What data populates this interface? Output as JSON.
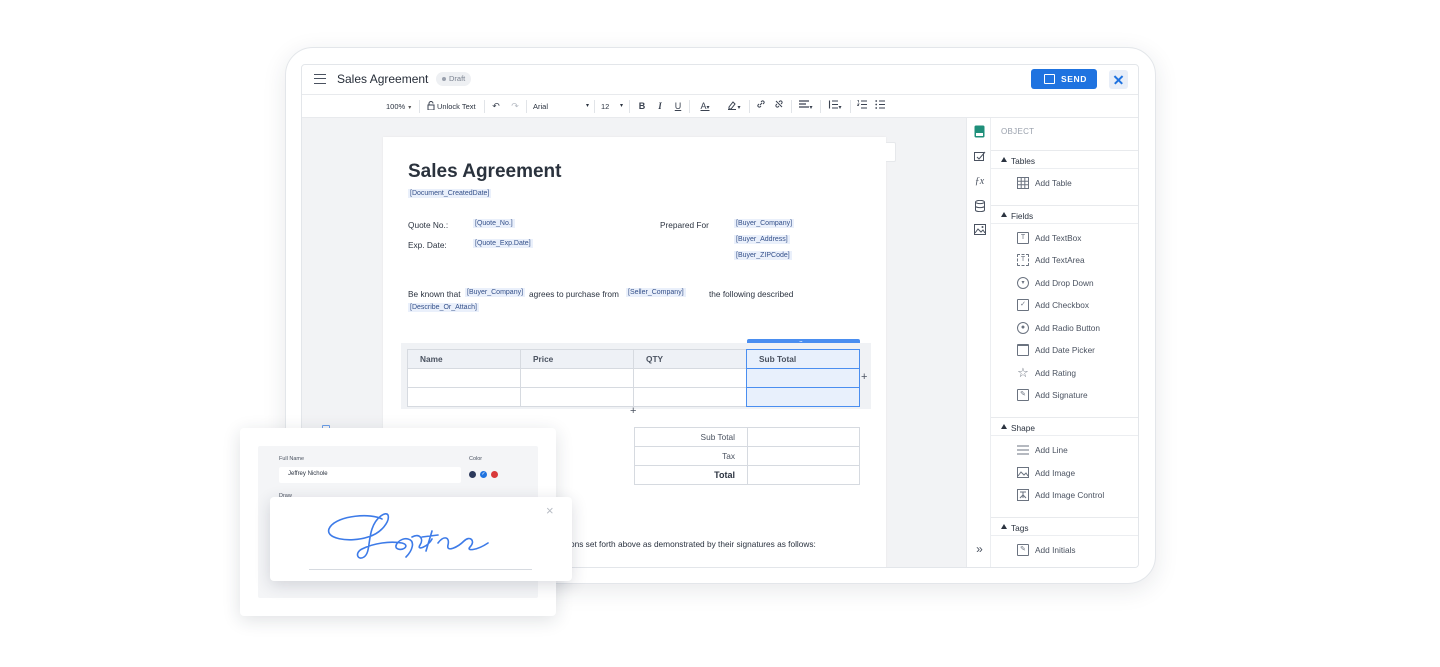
{
  "header": {
    "title": "Sales Agreement",
    "status": "Draft",
    "send_label": "SEND"
  },
  "toolbar": {
    "zoom": "100%",
    "unlock": "Unlock Text",
    "font": "Arial",
    "size": "12",
    "bold": "B",
    "italic": "I",
    "underline": "U",
    "text_color": "A"
  },
  "document": {
    "title": "Sales Agreement",
    "created_date": "[Document_CreatedDate]",
    "quote_no_label": "Quote No.:",
    "quote_no": "[Quote_No.]",
    "exp_date_label": "Exp. Date:",
    "exp_date": "[Quote_Exp.Date]",
    "prepared_for_label": "Prepared For",
    "buyer_company": "[Buyer_Company]",
    "buyer_address": "[Buyer_Address]",
    "buyer_zip": "[Buyer_ZIPCode]",
    "be_known": "Be known that",
    "agrees": "agrees to purchase from",
    "seller_company": "[Seller_Company]",
    "following": "the following described",
    "describe": "[Describe_Or_Attach]",
    "table_headers": [
      "Name",
      "Price",
      "QTY",
      "Sub Total"
    ],
    "summary_labels": [
      "Sub Total",
      "Tax",
      "Total"
    ],
    "closing_text": "ons set forth above as demonstrated by their signatures as follows:"
  },
  "panel": {
    "heading": "OBJECT",
    "sections": [
      {
        "title": "Tables",
        "items": [
          "Add Table"
        ]
      },
      {
        "title": "Fields",
        "items": [
          "Add TextBox",
          "Add TextArea",
          "Add Drop Down",
          "Add Checkbox",
          "Add Radio Button",
          "Add Date Picker",
          "Add Rating",
          "Add Signature"
        ]
      },
      {
        "title": "Shape",
        "items": [
          "Add Line",
          "Add Image",
          "Add Image Control"
        ]
      },
      {
        "title": "Tags",
        "items": [
          "Add Initials"
        ]
      }
    ]
  },
  "signature": {
    "full_name_label": "Full Name",
    "full_name_value": "Jeffrey Nichole",
    "color_label": "Color",
    "draw_label": "Draw",
    "colors": [
      "#2d3a5c",
      "#1f73e0",
      "#d93a3a"
    ]
  },
  "colors": {
    "accent": "#1f73e0",
    "tag_bg": "#eaf0fb",
    "selection": "#4a8ef0"
  }
}
